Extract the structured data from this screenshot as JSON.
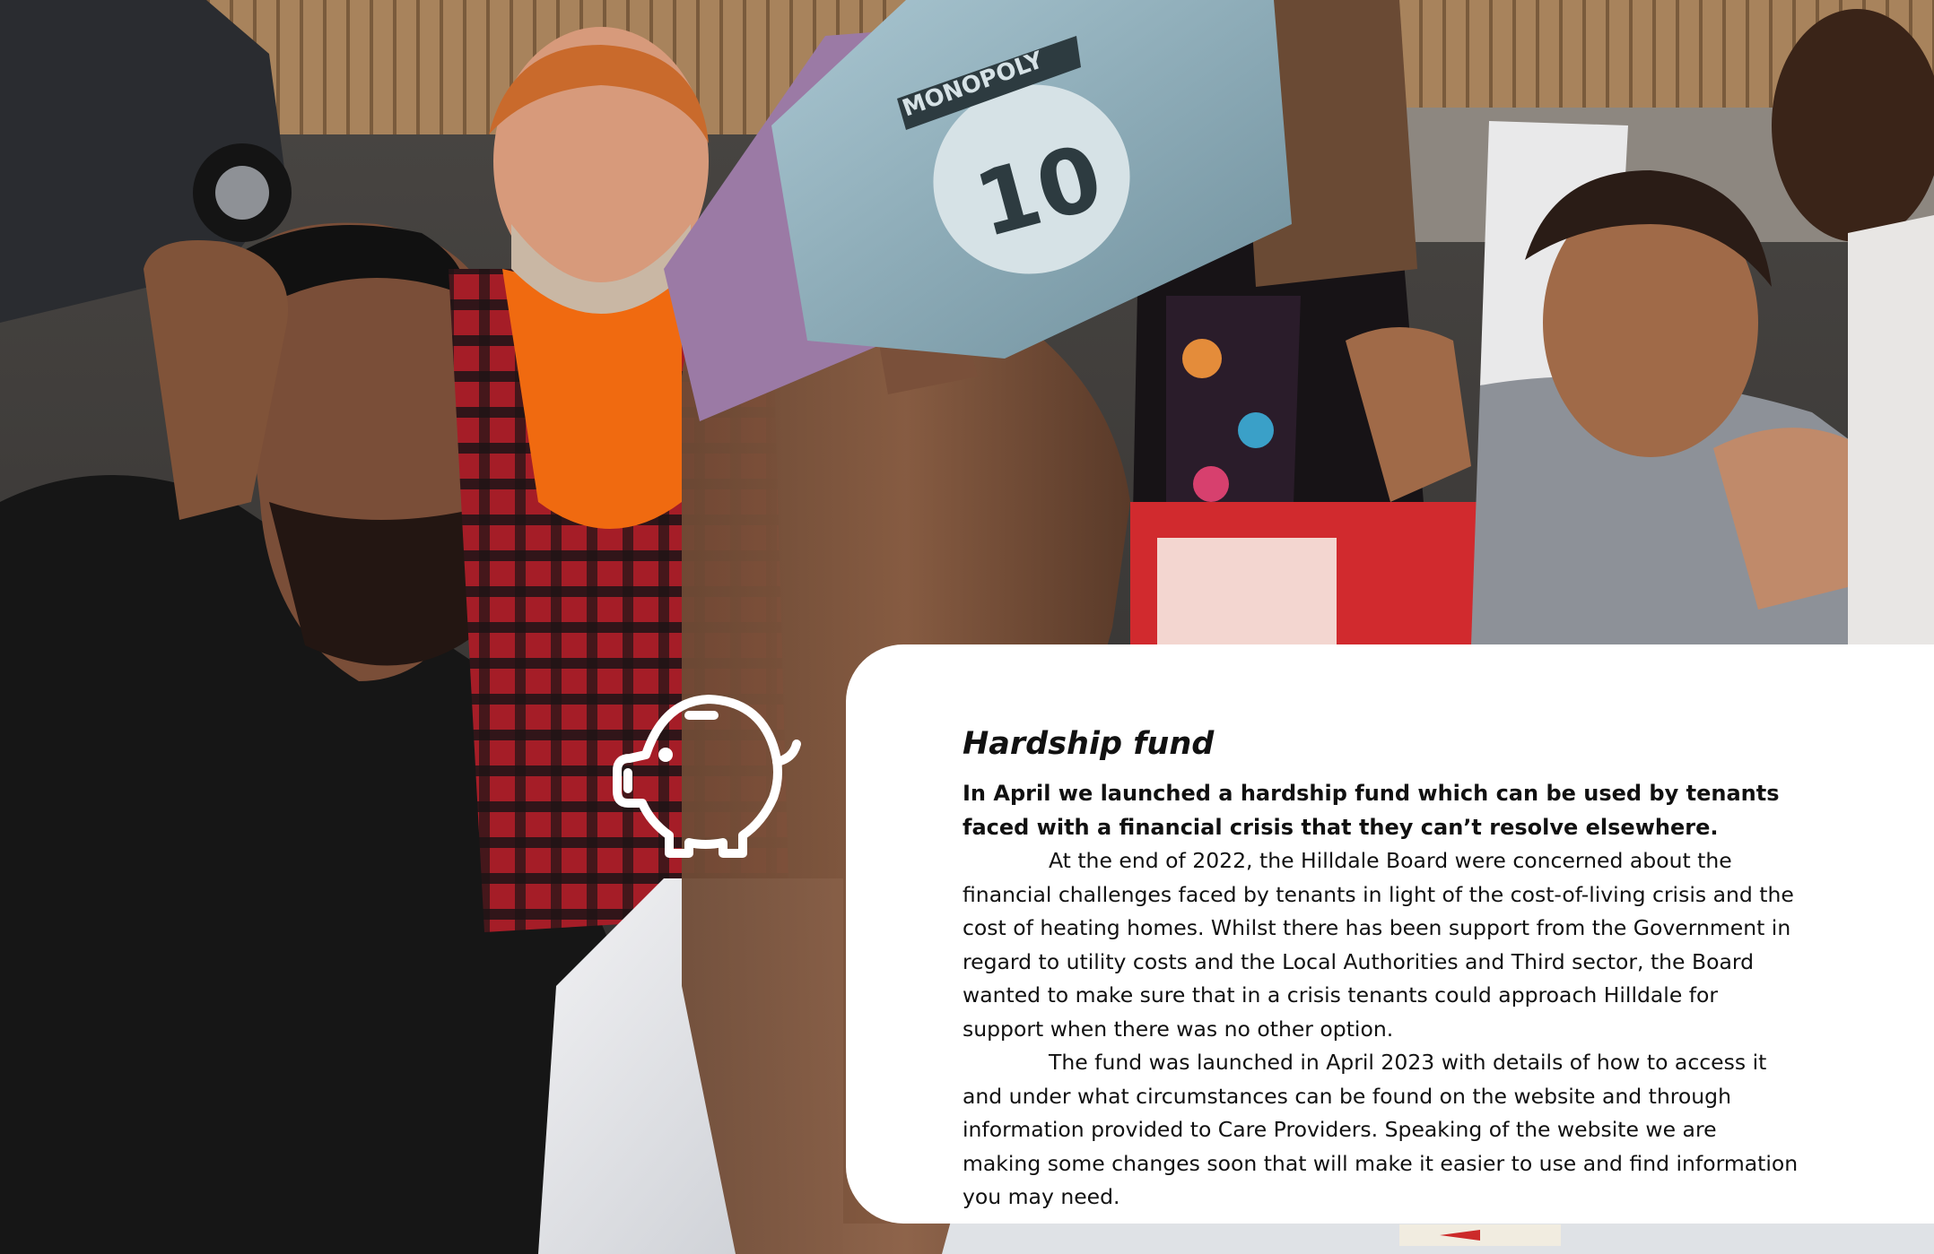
{
  "hero_image": {
    "banknote_value": "10",
    "banknote_brand": "MONOPOLY"
  },
  "icon": {
    "name": "piggy-bank-icon",
    "color": "#ffffff"
  },
  "article": {
    "title": "Hardship fund",
    "lead": "In April we launched a hardship fund which can be used by tenants faced with a financial crisis that they can’t resolve elsewhere.",
    "paragraphs": [
      "At the end of 2022, the Hilldale Board were concerned about the financial challenges faced by tenants in light of the cost-of-living crisis and the cost of heating homes. Whilst there has been support from the Government in regard to utility costs and the Local Authorities and Third sector, the Board wanted to make sure that in a crisis tenants could approach Hilldale for support when there was no other option.",
      "The fund was launched in April 2023 with details of how to access it and under what circumstances can be found on the website and through information provided to Care Providers. Speaking of the website we are making some changes soon that will make it easier to use and find information you may need."
    ]
  },
  "colors": {
    "card_background": "#ffffff",
    "text": "#111111",
    "orange_shirt": "#f06a10",
    "plaid_red": "#b3202b",
    "banknote_teal": "#8fb0bd",
    "banknote_purple": "#9b7aa5"
  }
}
